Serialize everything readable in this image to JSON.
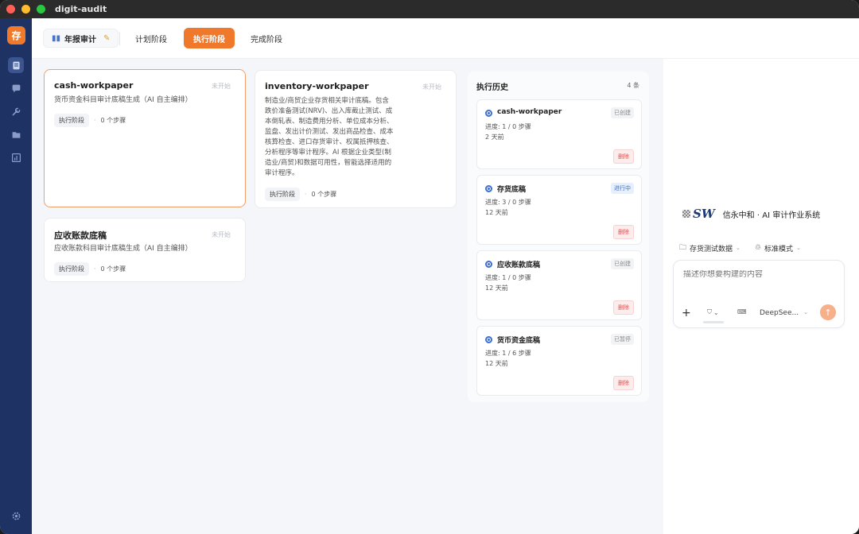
{
  "app": {
    "title": "digit-audit",
    "logo_char": "存"
  },
  "rail": {
    "items": [
      {
        "icon": "document-icon",
        "active": true
      },
      {
        "icon": "chat-icon",
        "active": false
      },
      {
        "icon": "wrench-icon",
        "active": false
      },
      {
        "icon": "folder-icon",
        "active": false
      },
      {
        "icon": "report-icon",
        "active": false
      }
    ],
    "bottom_icon": "settings-icon"
  },
  "topbar": {
    "annual_audit": "年报审计",
    "phases": [
      "计划阶段",
      "执行阶段",
      "完成阶段"
    ],
    "active_phase": "执行阶段"
  },
  "cards": [
    {
      "title": "cash-workpaper",
      "status": "未开始",
      "desc": "货币资金科目审计底稿生成（AI 自主编排）",
      "phase_tag": "执行阶段",
      "steps": "0 个步骤"
    },
    {
      "title": "inventory-workpaper",
      "status": "未开始",
      "desc_lines": [
        "制造业/商贸企业存货相关审计底稿。包含",
        "跌价准备测试(NRV)、出入库截止测试、成",
        "本倒轧表、制造费用分析、单位成本分析、",
        "监盘、发出计价测试、发出商品检查、成本",
        "核算检查、进口存货审计、权属抵押核查、",
        "分析程序等审计程序。AI 根据企业类型(制",
        "造业/商贸)和数据可用性，智能选择适用的",
        "审计程序。"
      ],
      "phase_tag": "执行阶段",
      "steps": "0 个步骤"
    },
    {
      "title": "应收账款底稿",
      "status": "未开始",
      "desc": "应收账款科目审计底稿生成（AI 自主编排）",
      "phase_tag": "执行阶段",
      "steps": "0 个步骤"
    }
  ],
  "history": {
    "title": "执行历史",
    "count": "4 条",
    "items": [
      {
        "name": "cash-workpaper",
        "badge": "已创建",
        "progress": "进度: 1 / 0 步骤",
        "time": "2 天前",
        "delete": "删除"
      },
      {
        "name": "存货底稿",
        "badge": "进行中",
        "progress": "进度: 3 / 0 步骤",
        "time": "12 天前",
        "delete": "删除"
      },
      {
        "name": "应收账款底稿",
        "badge": "已创建",
        "progress": "进度: 1 / 0 步骤",
        "time": "12 天前",
        "delete": "删除"
      },
      {
        "name": "货币资金底稿",
        "badge": "已暂停",
        "progress": "进度: 1 / 6 步骤",
        "time": "12 天前",
        "delete": "删除"
      }
    ]
  },
  "assistant": {
    "logo_text": "SW",
    "brand": "信永中和 · AI 审计作业系统",
    "data_option": "存货测试数据",
    "mode_option": "标准模式",
    "placeholder": "描述你想要构建的内容",
    "model": "DeepSee..."
  },
  "colors": {
    "accent": "#f0782a",
    "rail": "#1e3264",
    "link_blue": "#3a6ed6",
    "danger": "#e0504f"
  }
}
